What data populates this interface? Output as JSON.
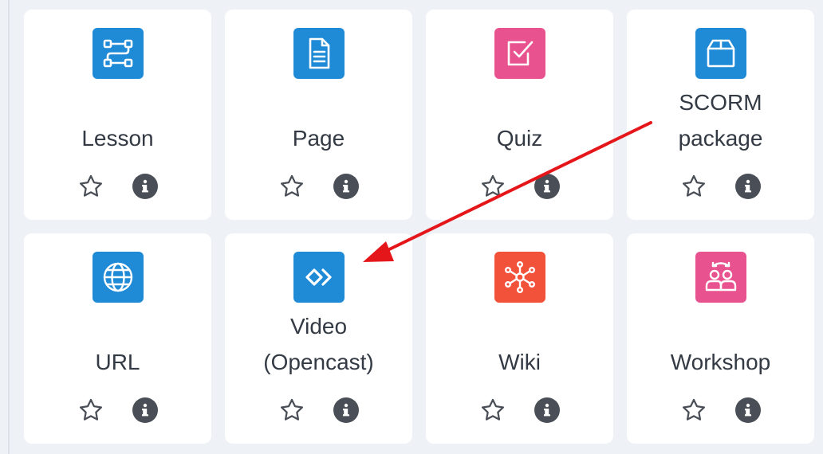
{
  "colors": {
    "blue": "#1f8bd6",
    "pink": "#e8528f",
    "red": "#f2513a",
    "arrow": "#e5161a"
  },
  "activities": [
    {
      "label": "Lesson",
      "icon": "lesson-path-icon",
      "color": "#1f8bd6"
    },
    {
      "label": "Page",
      "icon": "page-document-icon",
      "color": "#1f8bd6"
    },
    {
      "label": "Quiz",
      "icon": "quiz-checkbox-icon",
      "color": "#e8528f"
    },
    {
      "label": "SCORM\npackage",
      "icon": "scorm-box-icon",
      "color": "#1f8bd6"
    },
    {
      "label": "URL",
      "icon": "url-globe-icon",
      "color": "#1f8bd6"
    },
    {
      "label": "Video\n(Opencast)",
      "icon": "opencast-video-icon",
      "color": "#1f8bd6"
    },
    {
      "label": "Wiki",
      "icon": "wiki-network-icon",
      "color": "#f2513a"
    },
    {
      "label": "Workshop",
      "icon": "workshop-people-icon",
      "color": "#e8528f"
    }
  ],
  "actions": {
    "star_icon": "star-outline-icon",
    "info_icon": "info-icon"
  },
  "annotation": {
    "type": "red arrow pointing to Video (Opencast)"
  }
}
